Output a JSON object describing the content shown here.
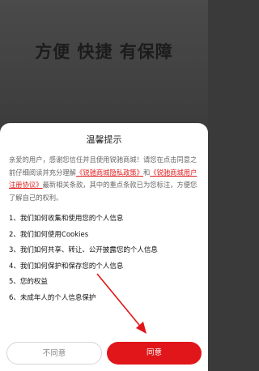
{
  "background": {
    "slogan": "方便 快捷 有保障"
  },
  "dialog": {
    "title": "温馨提示",
    "intro_prefix": "亲爱的用户，感谢您信任并且使用锐驰商城！请您在点击同意之前仔细阅读并充分理解",
    "link_privacy": "《锐驰商城隐私政策》",
    "intro_and": "和",
    "link_agreement": "《锐驰商城用户注册协议》",
    "intro_suffix": "最新相关条款，其中的重点条款已为您标注，方便您了解自己的权利。",
    "items": [
      "1、我们如何收集和使用您的个人信息",
      "2、我们如何使用Cookies",
      "3、我们如何共享、转让、公开披露您的个人信息",
      "4、我们如何保护和保存您的个人信息",
      "5、您的权益",
      "6、未成年人的个人信息保护"
    ],
    "disagree_label": "不同意",
    "agree_label": "同意"
  },
  "colors": {
    "accent": "#e0161a",
    "link": "#e02020"
  }
}
